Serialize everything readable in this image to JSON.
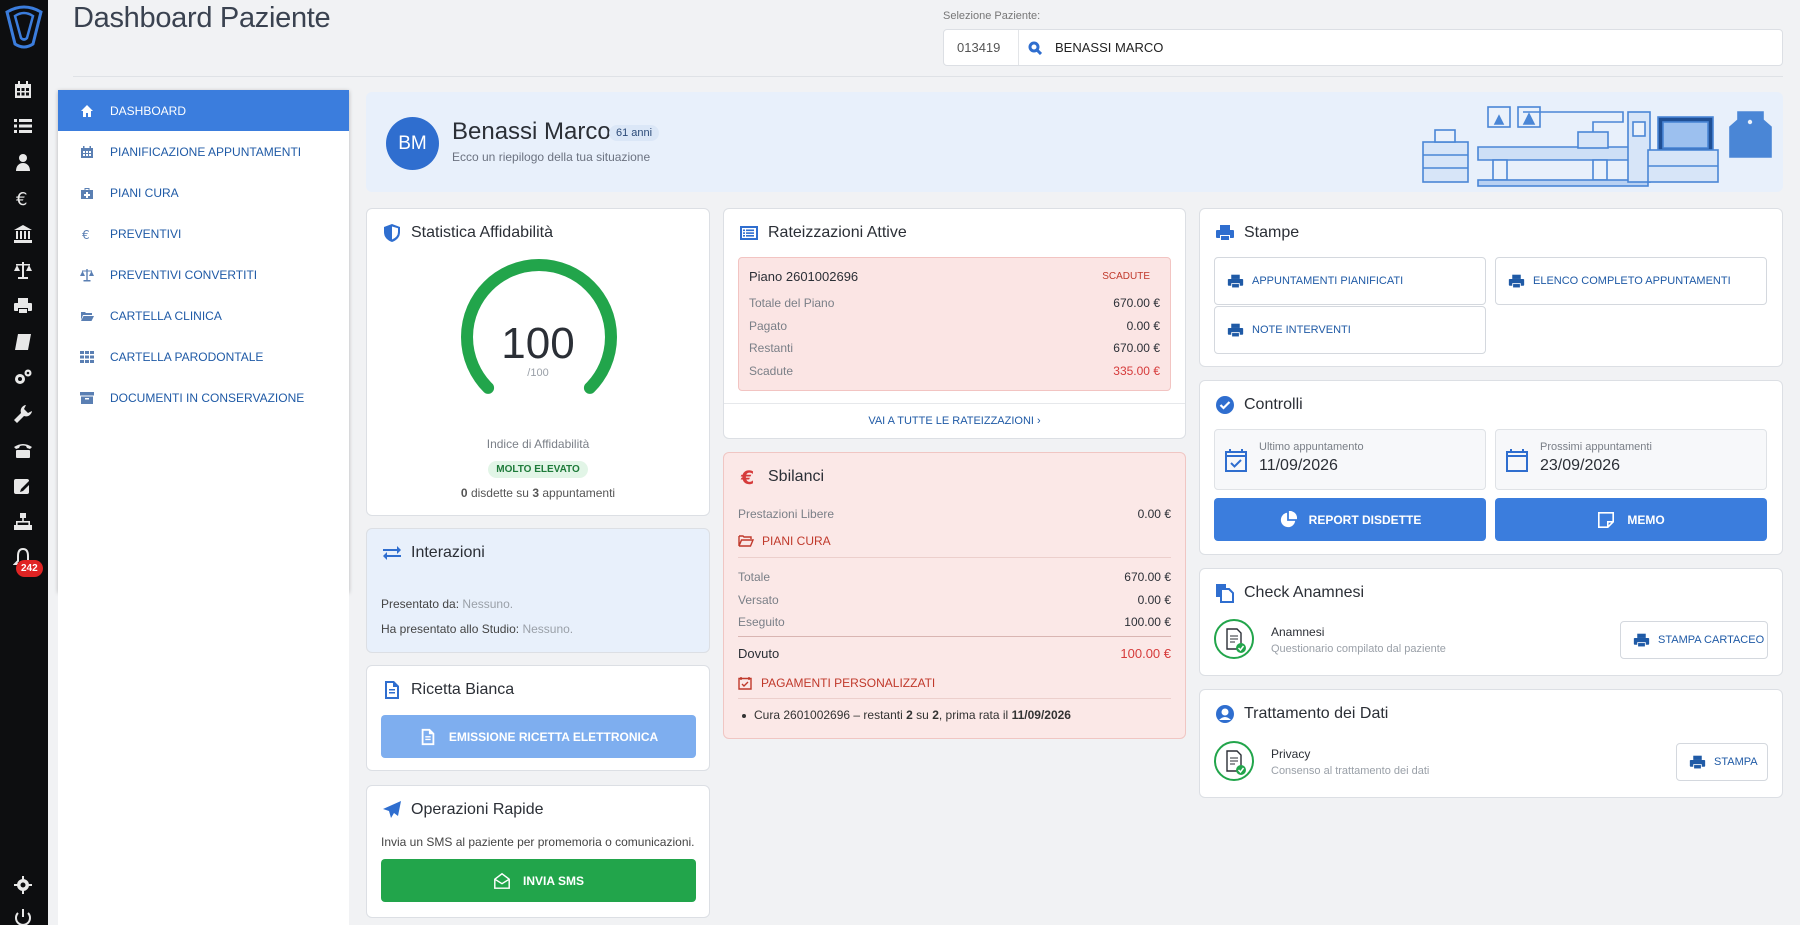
{
  "header": {
    "title": "Dashboard Paziente",
    "select_label": "Selezione Paziente:",
    "patient_code": "013419",
    "patient_name": "BENASSI MARCO"
  },
  "rail": {
    "icons": [
      "calendar-icon",
      "list-icon",
      "users-icon",
      "euro-icon",
      "bank-icon",
      "scale-icon",
      "printer-icon",
      "book-icon",
      "cogs-icon",
      "wrench-icon",
      "phone-icon",
      "edit-icon",
      "sitemap-icon",
      "bell-icon"
    ],
    "bell_badge": "242",
    "bottom_icons": [
      "settings-icon",
      "power-icon"
    ]
  },
  "menu": {
    "items": [
      {
        "label": "DASHBOARD",
        "icon": "home-icon"
      },
      {
        "label": "PIANIFICAZIONE APPUNTAMENTI",
        "icon": "calendar-icon"
      },
      {
        "label": "PIANI CURA",
        "icon": "medkit-icon"
      },
      {
        "label": "PREVENTIVI",
        "icon": "euro-icon"
      },
      {
        "label": "PREVENTIVI CONVERTITI",
        "icon": "scale-icon"
      },
      {
        "label": "CARTELLA CLINICA",
        "icon": "folder-open-icon"
      },
      {
        "label": "CARTELLA PARODONTALE",
        "icon": "grid-icon"
      },
      {
        "label": "DOCUMENTI IN CONSERVAZIONE",
        "icon": "archive-icon"
      }
    ]
  },
  "banner": {
    "initials": "BM",
    "name": "Benassi Marco",
    "age": "61 anni",
    "subtitle": "Ecco un riepilogo della tua situazione"
  },
  "affidabilita": {
    "title": "Statistica Affidabilità",
    "score": "100",
    "max": "/100",
    "score_fraction": 1.0,
    "index_label": "Indice di Affidabilità",
    "level": "MOLTO ELEVATO",
    "disdette": "0",
    "disdette_text": "disdette su",
    "appuntamenti": "3",
    "appuntamenti_text": "appuntamenti"
  },
  "interazioni": {
    "title": "Interazioni",
    "presentato_da_label": "Presentato da:",
    "presentato_da_value": "Nessuno.",
    "ha_presentato_label": "Ha presentato allo Studio:",
    "ha_presentato_value": "Nessuno."
  },
  "ricetta": {
    "title": "Ricetta Bianca",
    "button": "EMISSIONE RICETTA ELETTRONICA"
  },
  "operazioni": {
    "title": "Operazioni Rapide",
    "text": "Invia un SMS al paziente per promemoria o comunicazioni.",
    "button": "INVIA SMS"
  },
  "rateizzazioni": {
    "title": "Rateizzazioni Attive",
    "piano": "Piano 2601002696",
    "status": "SCADUTE",
    "rows": [
      {
        "label": "Totale del Piano",
        "value": "670.00 €"
      },
      {
        "label": "Pagato",
        "value": "0.00 €"
      },
      {
        "label": "Restanti",
        "value": "670.00 €"
      },
      {
        "label": "Scadute",
        "value": "335.00 €"
      }
    ],
    "link": "VAI A TUTTE LE RATEIZZAZIONI ›"
  },
  "sbilanci": {
    "title": "Sbilanci",
    "prestazioni_label": "Prestazioni Libere",
    "prestazioni_value": "0.00 €",
    "piani_cura": "PIANI CURA",
    "rows": [
      {
        "label": "Totale",
        "value": "670.00 €"
      },
      {
        "label": "Versato",
        "value": "0.00 €"
      },
      {
        "label": "Eseguito",
        "value": "100.00 €"
      }
    ],
    "dovuto_label": "Dovuto",
    "dovuto_value": "100.00 €",
    "pagamenti": "PAGAMENTI PERSONALIZZATI",
    "bullet_pre": "Cura 2601002696 – restanti",
    "bullet_n1": "2",
    "bullet_su": "su",
    "bullet_n2": "2",
    "bullet_mid": ", prima rata il",
    "bullet_date": "11/09/2026"
  },
  "stampe": {
    "title": "Stampe",
    "buttons": [
      "APPUNTAMENTI PIANIFICATI",
      "ELENCO COMPLETO APPUNTAMENTI",
      "NOTE INTERVENTI"
    ]
  },
  "controlli": {
    "title": "Controlli",
    "ultimo_label": "Ultimo appuntamento",
    "ultimo_value": "11/09/2026",
    "prossimi_label": "Prossimi appuntamenti",
    "prossimi_value": "23/09/2026",
    "report_button": "REPORT DISDETTE",
    "memo_button": "MEMO"
  },
  "anamnesi": {
    "title": "Check Anamnesi",
    "name": "Anamnesi",
    "desc": "Questionario compilato dal paziente",
    "button": "STAMPA CARTACEO"
  },
  "privacy": {
    "title": "Trattamento dei Dati",
    "name": "Privacy",
    "desc": "Consenso al trattamento dei dati",
    "button": "STAMPA"
  },
  "colors": {
    "primary": "#3b7ddd",
    "green": "#22a54b",
    "danger": "#d63b3b"
  }
}
